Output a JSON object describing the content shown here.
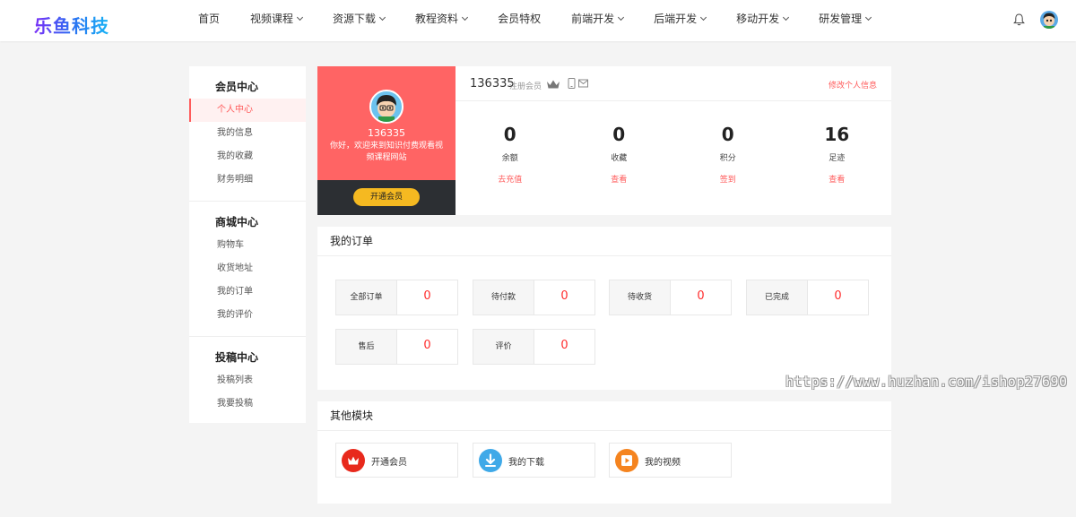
{
  "header": {
    "logo": "乐鱼科技",
    "nav": [
      {
        "label": "首页",
        "dropdown": false
      },
      {
        "label": "视频课程",
        "dropdown": true
      },
      {
        "label": "资源下载",
        "dropdown": true
      },
      {
        "label": "教程资料",
        "dropdown": true
      },
      {
        "label": "会员特权",
        "dropdown": false
      },
      {
        "label": "前端开发",
        "dropdown": true
      },
      {
        "label": "后端开发",
        "dropdown": true
      },
      {
        "label": "移动开发",
        "dropdown": true
      },
      {
        "label": "研发管理",
        "dropdown": true
      }
    ],
    "icons": [
      "bell-icon",
      "user-avatar"
    ]
  },
  "sidebar": {
    "groups": [
      {
        "title": "会员中心",
        "items": [
          "个人中心",
          "我的信息",
          "我的收藏",
          "财务明细"
        ]
      },
      {
        "title": "商城中心",
        "items": [
          "购物车",
          "收货地址",
          "我的订单",
          "我的评价"
        ]
      },
      {
        "title": "投稿中心",
        "items": [
          "投稿列表",
          "我要投稿"
        ]
      }
    ],
    "active_item": "个人中心"
  },
  "profile": {
    "username": "136335",
    "welcome": "你好，欢迎来到知识付费观看视频课程网站",
    "open_vip_label": "开通会员",
    "level": "注册会员",
    "edit_label": "修改个人信息",
    "stats": [
      {
        "value": "0",
        "label": "余额",
        "action": "去充值"
      },
      {
        "value": "0",
        "label": "收藏",
        "action": "查看"
      },
      {
        "value": "0",
        "label": "积分",
        "action": "签到"
      },
      {
        "value": "16",
        "label": "足迹",
        "action": "查看"
      }
    ]
  },
  "orders": {
    "title": "我的订单",
    "items": [
      {
        "label": "全部订单",
        "count": "0"
      },
      {
        "label": "待付款",
        "count": "0"
      },
      {
        "label": "待收货",
        "count": "0"
      },
      {
        "label": "已完成",
        "count": "0"
      },
      {
        "label": "售后",
        "count": "0"
      },
      {
        "label": "评价",
        "count": "0"
      }
    ]
  },
  "others": {
    "title": "其他模块",
    "items": [
      {
        "label": "开通会员",
        "icon": "crown-icon",
        "color": "#e8291c"
      },
      {
        "label": "我的下载",
        "icon": "download-icon",
        "color": "#3fa9e8"
      },
      {
        "label": "我的视频",
        "icon": "play-icon",
        "color": "#f5841f"
      }
    ]
  },
  "watermark": "https://www.huzhan.com/ishop27690",
  "colors": {
    "accent": "#ff5a5a",
    "profile_bg": "#ff6464",
    "vip_button": "#f5b921",
    "order_count": "#ff2d2d"
  }
}
